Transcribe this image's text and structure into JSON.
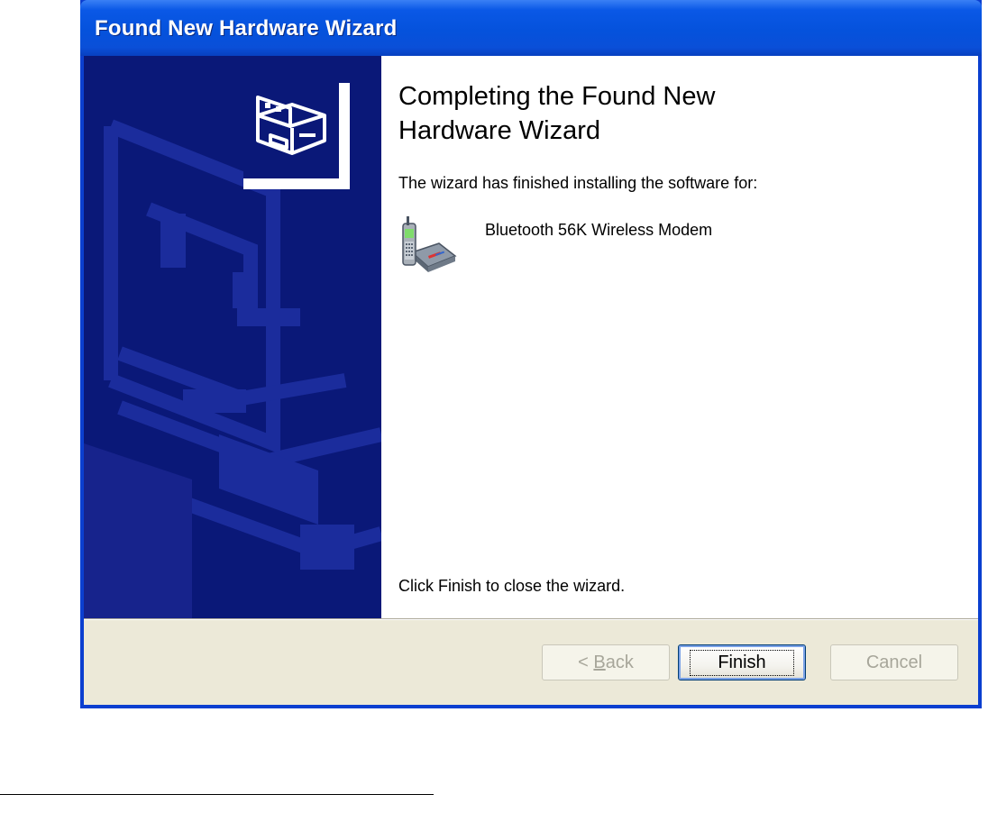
{
  "window": {
    "title": "Found New Hardware Wizard"
  },
  "wizard": {
    "heading_line1": "Completing the Found New",
    "heading_line2": "Hardware Wizard",
    "intro": "The wizard has finished installing the software for:",
    "device_name": "Bluetooth 56K Wireless Modem",
    "device_icon": "bluetooth-modem-icon",
    "finish_hint": "Click Finish to close the wizard."
  },
  "buttons": {
    "back_prefix": "< ",
    "back_mnemonic": "B",
    "back_rest": "ack",
    "finish": "Finish",
    "cancel": "Cancel"
  },
  "colors": {
    "titlebar": "#0552dc",
    "side_panel": "#0a1878",
    "dialog_face": "#ece9d8"
  }
}
